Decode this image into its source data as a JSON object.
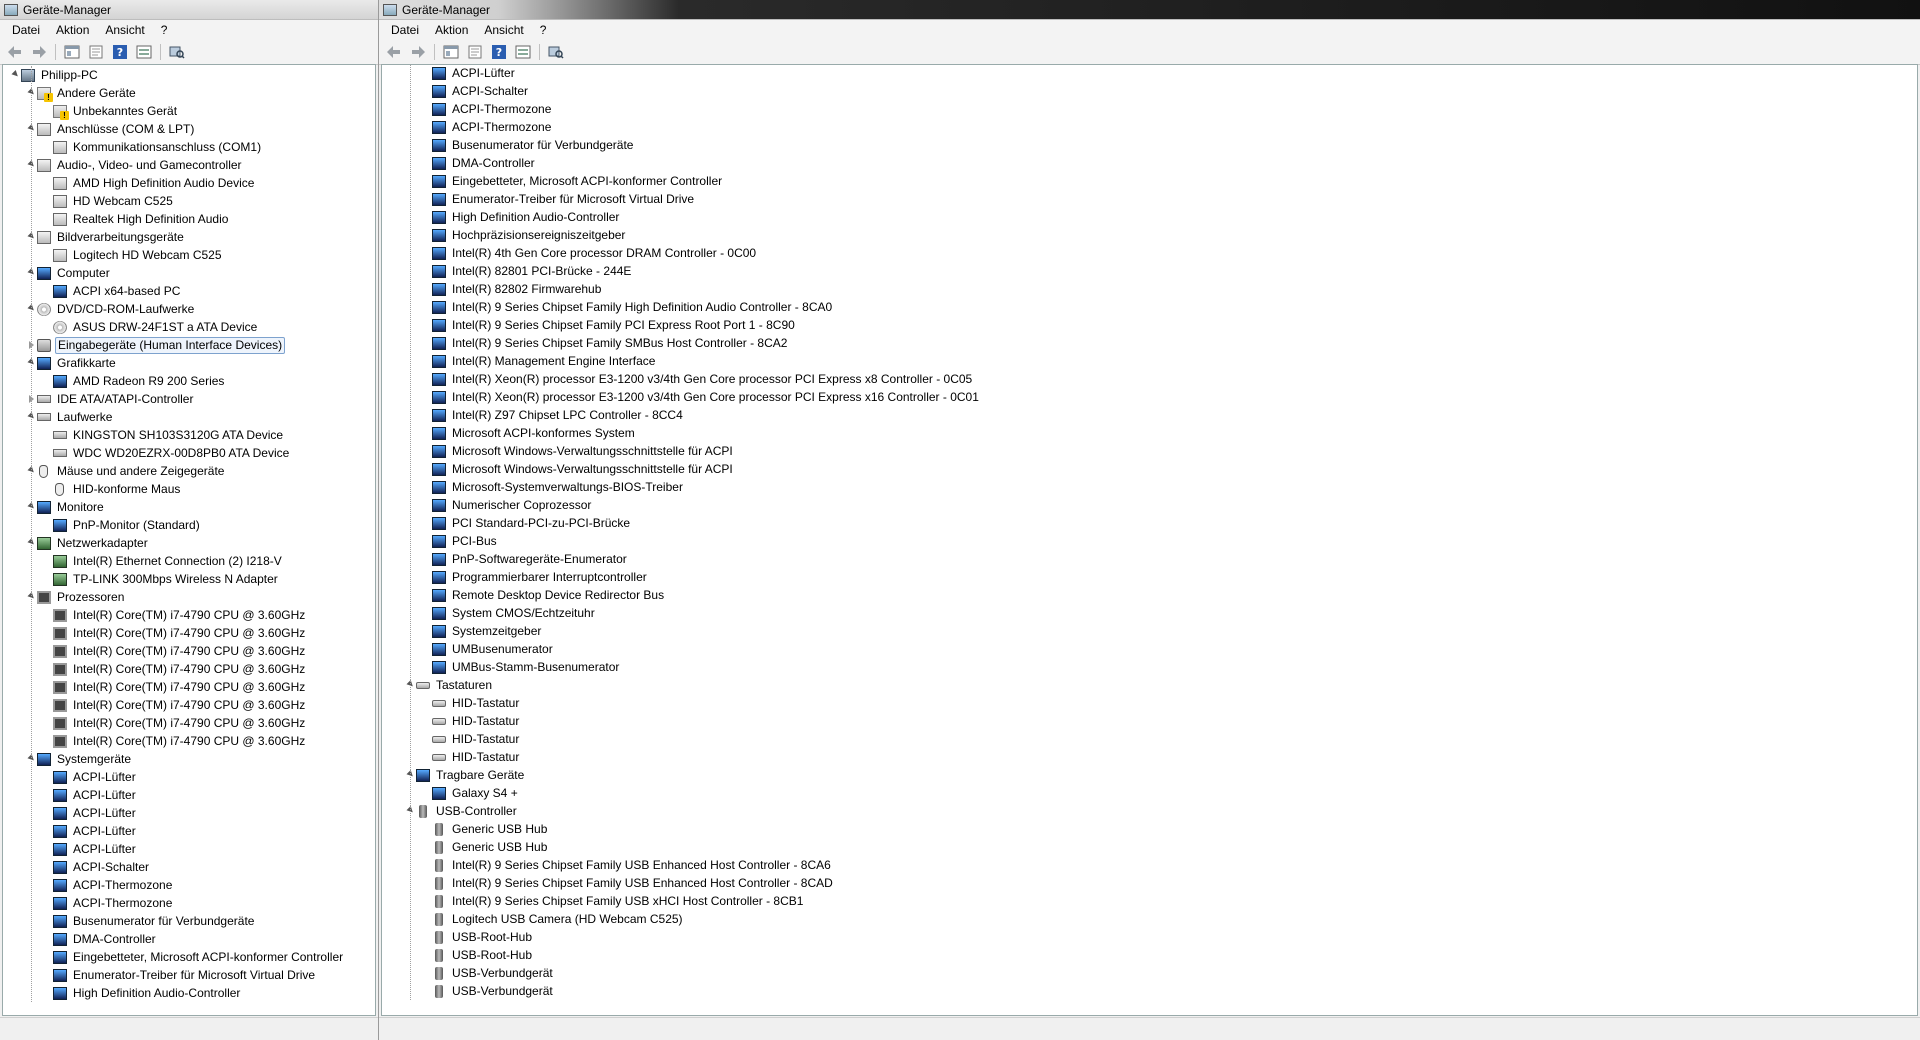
{
  "left": {
    "title": "Geräte-Manager",
    "menu": [
      "Datei",
      "Aktion",
      "Ansicht",
      "?"
    ],
    "tree": [
      {
        "label": "Philipp-PC",
        "depth": 0,
        "toggle": "expanded",
        "icon": "computer-icon"
      },
      {
        "label": "Andere Geräte",
        "depth": 1,
        "toggle": "expanded",
        "icon": "other-devices-icon"
      },
      {
        "label": "Unbekanntes Gerät",
        "depth": 2,
        "icon": "unknown-device-warning-icon"
      },
      {
        "label": "Anschlüsse (COM & LPT)",
        "depth": 1,
        "toggle": "expanded",
        "icon": "port-icon"
      },
      {
        "label": "Kommunikationsanschluss (COM1)",
        "depth": 2,
        "icon": "port-icon"
      },
      {
        "label": "Audio-, Video- und Gamecontroller",
        "depth": 1,
        "toggle": "expanded",
        "icon": "speaker-icon"
      },
      {
        "label": "AMD High Definition Audio Device",
        "depth": 2,
        "icon": "speaker-icon"
      },
      {
        "label": "HD Webcam C525",
        "depth": 2,
        "icon": "speaker-icon"
      },
      {
        "label": "Realtek High Definition Audio",
        "depth": 2,
        "icon": "speaker-icon"
      },
      {
        "label": "Bildverarbeitungsgeräte",
        "depth": 1,
        "toggle": "expanded",
        "icon": "camera-icon"
      },
      {
        "label": "Logitech HD Webcam C525",
        "depth": 2,
        "icon": "camera-icon"
      },
      {
        "label": "Computer",
        "depth": 1,
        "toggle": "expanded",
        "icon": "monitor-icon"
      },
      {
        "label": "ACPI x64-based PC",
        "depth": 2,
        "icon": "monitor-icon"
      },
      {
        "label": "DVD/CD-ROM-Laufwerke",
        "depth": 1,
        "toggle": "expanded",
        "icon": "cd-drive-icon"
      },
      {
        "label": "ASUS DRW-24F1ST   a ATA Device",
        "depth": 2,
        "icon": "cd-drive-icon"
      },
      {
        "label": "Eingabegeräte (Human Interface Devices)",
        "depth": 1,
        "toggle": "collapsed",
        "icon": "hid-icon",
        "selected": true
      },
      {
        "label": "Grafikkarte",
        "depth": 1,
        "toggle": "expanded",
        "icon": "display-adapter-icon"
      },
      {
        "label": "AMD Radeon R9 200 Series",
        "depth": 2,
        "icon": "display-adapter-icon"
      },
      {
        "label": "IDE ATA/ATAPI-Controller",
        "depth": 1,
        "toggle": "collapsed",
        "icon": "ide-controller-icon"
      },
      {
        "label": "Laufwerke",
        "depth": 1,
        "toggle": "expanded",
        "icon": "disk-drive-icon"
      },
      {
        "label": "KINGSTON SH103S3120G ATA Device",
        "depth": 2,
        "icon": "disk-drive-icon"
      },
      {
        "label": "WDC WD20EZRX-00D8PB0 ATA Device",
        "depth": 2,
        "icon": "disk-drive-icon"
      },
      {
        "label": "Mäuse und andere Zeigegeräte",
        "depth": 1,
        "toggle": "expanded",
        "icon": "mouse-icon"
      },
      {
        "label": "HID-konforme Maus",
        "depth": 2,
        "icon": "mouse-icon"
      },
      {
        "label": "Monitore",
        "depth": 1,
        "toggle": "expanded",
        "icon": "monitor-icon"
      },
      {
        "label": "PnP-Monitor (Standard)",
        "depth": 2,
        "icon": "monitor-icon"
      },
      {
        "label": "Netzwerkadapter",
        "depth": 1,
        "toggle": "expanded",
        "icon": "network-adapter-icon"
      },
      {
        "label": "Intel(R) Ethernet Connection (2) I218-V",
        "depth": 2,
        "icon": "network-adapter-icon"
      },
      {
        "label": "TP-LINK 300Mbps Wireless N Adapter",
        "depth": 2,
        "icon": "network-adapter-icon"
      },
      {
        "label": "Prozessoren",
        "depth": 1,
        "toggle": "expanded",
        "icon": "processor-icon"
      },
      {
        "label": "Intel(R) Core(TM) i7-4790 CPU @ 3.60GHz",
        "depth": 2,
        "icon": "processor-icon"
      },
      {
        "label": "Intel(R) Core(TM) i7-4790 CPU @ 3.60GHz",
        "depth": 2,
        "icon": "processor-icon"
      },
      {
        "label": "Intel(R) Core(TM) i7-4790 CPU @ 3.60GHz",
        "depth": 2,
        "icon": "processor-icon"
      },
      {
        "label": "Intel(R) Core(TM) i7-4790 CPU @ 3.60GHz",
        "depth": 2,
        "icon": "processor-icon"
      },
      {
        "label": "Intel(R) Core(TM) i7-4790 CPU @ 3.60GHz",
        "depth": 2,
        "icon": "processor-icon"
      },
      {
        "label": "Intel(R) Core(TM) i7-4790 CPU @ 3.60GHz",
        "depth": 2,
        "icon": "processor-icon"
      },
      {
        "label": "Intel(R) Core(TM) i7-4790 CPU @ 3.60GHz",
        "depth": 2,
        "icon": "processor-icon"
      },
      {
        "label": "Intel(R) Core(TM) i7-4790 CPU @ 3.60GHz",
        "depth": 2,
        "icon": "processor-icon"
      },
      {
        "label": "Systemgeräte",
        "depth": 1,
        "toggle": "expanded",
        "icon": "system-device-icon"
      },
      {
        "label": "ACPI-Lüfter",
        "depth": 2,
        "icon": "system-device-icon"
      },
      {
        "label": "ACPI-Lüfter",
        "depth": 2,
        "icon": "system-device-icon"
      },
      {
        "label": "ACPI-Lüfter",
        "depth": 2,
        "icon": "system-device-icon"
      },
      {
        "label": "ACPI-Lüfter",
        "depth": 2,
        "icon": "system-device-icon"
      },
      {
        "label": "ACPI-Lüfter",
        "depth": 2,
        "icon": "system-device-icon"
      },
      {
        "label": "ACPI-Schalter",
        "depth": 2,
        "icon": "system-device-icon"
      },
      {
        "label": "ACPI-Thermozone",
        "depth": 2,
        "icon": "system-device-icon"
      },
      {
        "label": "ACPI-Thermozone",
        "depth": 2,
        "icon": "system-device-icon"
      },
      {
        "label": "Busenumerator für Verbundgeräte",
        "depth": 2,
        "icon": "system-device-icon"
      },
      {
        "label": "DMA-Controller",
        "depth": 2,
        "icon": "system-device-icon"
      },
      {
        "label": "Eingebetteter, Microsoft ACPI-konformer Controller",
        "depth": 2,
        "icon": "system-device-icon"
      },
      {
        "label": "Enumerator-Treiber für Microsoft Virtual Drive",
        "depth": 2,
        "icon": "system-device-icon"
      },
      {
        "label": "High Definition Audio-Controller",
        "depth": 2,
        "icon": "system-device-icon"
      }
    ]
  },
  "right": {
    "title": "Geräte-Manager",
    "menu": [
      "Datei",
      "Aktion",
      "Ansicht",
      "?"
    ],
    "tree": [
      {
        "label": "ACPI-Lüfter",
        "depth": 2,
        "icon": "system-device-icon"
      },
      {
        "label": "ACPI-Schalter",
        "depth": 2,
        "icon": "system-device-icon"
      },
      {
        "label": "ACPI-Thermozone",
        "depth": 2,
        "icon": "system-device-icon"
      },
      {
        "label": "ACPI-Thermozone",
        "depth": 2,
        "icon": "system-device-icon"
      },
      {
        "label": "Busenumerator für Verbundgeräte",
        "depth": 2,
        "icon": "system-device-icon"
      },
      {
        "label": "DMA-Controller",
        "depth": 2,
        "icon": "system-device-icon"
      },
      {
        "label": "Eingebetteter, Microsoft ACPI-konformer Controller",
        "depth": 2,
        "icon": "system-device-icon"
      },
      {
        "label": "Enumerator-Treiber für Microsoft Virtual Drive",
        "depth": 2,
        "icon": "system-device-icon"
      },
      {
        "label": "High Definition Audio-Controller",
        "depth": 2,
        "icon": "system-device-icon"
      },
      {
        "label": "Hochpräzisionsereigniszeitgeber",
        "depth": 2,
        "icon": "system-device-icon"
      },
      {
        "label": "Intel(R) 4th Gen Core processor DRAM Controller - 0C00",
        "depth": 2,
        "icon": "system-device-icon"
      },
      {
        "label": "Intel(R) 82801 PCI-Brücke - 244E",
        "depth": 2,
        "icon": "system-device-icon"
      },
      {
        "label": "Intel(R) 82802 Firmwarehub",
        "depth": 2,
        "icon": "system-device-icon"
      },
      {
        "label": "Intel(R) 9 Series Chipset Family High Definition Audio Controller  - 8CA0",
        "depth": 2,
        "icon": "system-device-icon"
      },
      {
        "label": "Intel(R) 9 Series Chipset Family PCI Express Root Port 1 - 8C90",
        "depth": 2,
        "icon": "system-device-icon"
      },
      {
        "label": "Intel(R) 9 Series Chipset Family SMBus Host Controller  - 8CA2",
        "depth": 2,
        "icon": "system-device-icon"
      },
      {
        "label": "Intel(R) Management Engine Interface",
        "depth": 2,
        "icon": "system-device-icon"
      },
      {
        "label": "Intel(R) Xeon(R) processor E3-1200 v3/4th Gen Core processor PCI Express x8 Controller - 0C05",
        "depth": 2,
        "icon": "system-device-icon"
      },
      {
        "label": "Intel(R) Xeon(R) processor E3-1200 v3/4th Gen Core processor PCI Express x16 Controller - 0C01",
        "depth": 2,
        "icon": "system-device-icon"
      },
      {
        "label": "Intel(R) Z97 Chipset LPC Controller  - 8CC4",
        "depth": 2,
        "icon": "system-device-icon"
      },
      {
        "label": "Microsoft ACPI-konformes System",
        "depth": 2,
        "icon": "system-device-icon"
      },
      {
        "label": "Microsoft Windows-Verwaltungsschnittstelle für ACPI",
        "depth": 2,
        "icon": "system-device-icon"
      },
      {
        "label": "Microsoft Windows-Verwaltungsschnittstelle für ACPI",
        "depth": 2,
        "icon": "system-device-icon"
      },
      {
        "label": "Microsoft-Systemverwaltungs-BIOS-Treiber",
        "depth": 2,
        "icon": "system-device-icon"
      },
      {
        "label": "Numerischer Coprozessor",
        "depth": 2,
        "icon": "system-device-icon"
      },
      {
        "label": "PCI Standard-PCI-zu-PCI-Brücke",
        "depth": 2,
        "icon": "system-device-icon"
      },
      {
        "label": "PCI-Bus",
        "depth": 2,
        "icon": "system-device-icon"
      },
      {
        "label": "PnP-Softwaregeräte-Enumerator",
        "depth": 2,
        "icon": "system-device-icon"
      },
      {
        "label": "Programmierbarer Interruptcontroller",
        "depth": 2,
        "icon": "system-device-icon"
      },
      {
        "label": "Remote Desktop Device Redirector Bus",
        "depth": 2,
        "icon": "system-device-icon"
      },
      {
        "label": "System CMOS/Echtzeituhr",
        "depth": 2,
        "icon": "system-device-icon"
      },
      {
        "label": "Systemzeitgeber",
        "depth": 2,
        "icon": "system-device-icon"
      },
      {
        "label": "UMBusenumerator",
        "depth": 2,
        "icon": "system-device-icon"
      },
      {
        "label": "UMBus-Stamm-Busenumerator",
        "depth": 2,
        "icon": "system-device-icon"
      },
      {
        "label": "Tastaturen",
        "depth": 1,
        "toggle": "expanded",
        "icon": "keyboard-icon"
      },
      {
        "label": "HID-Tastatur",
        "depth": 2,
        "icon": "keyboard-icon"
      },
      {
        "label": "HID-Tastatur",
        "depth": 2,
        "icon": "keyboard-icon"
      },
      {
        "label": "HID-Tastatur",
        "depth": 2,
        "icon": "keyboard-icon"
      },
      {
        "label": "HID-Tastatur",
        "depth": 2,
        "icon": "keyboard-icon"
      },
      {
        "label": "Tragbare Geräte",
        "depth": 1,
        "toggle": "expanded",
        "icon": "portable-device-icon"
      },
      {
        "label": "Galaxy S4 +",
        "depth": 2,
        "icon": "portable-device-icon"
      },
      {
        "label": "USB-Controller",
        "depth": 1,
        "toggle": "expanded",
        "icon": "usb-icon"
      },
      {
        "label": "Generic USB Hub",
        "depth": 2,
        "icon": "usb-icon"
      },
      {
        "label": "Generic USB Hub",
        "depth": 2,
        "icon": "usb-icon"
      },
      {
        "label": "Intel(R) 9 Series Chipset Family USB Enhanced Host Controller  - 8CA6",
        "depth": 2,
        "icon": "usb-icon"
      },
      {
        "label": "Intel(R) 9 Series Chipset Family USB Enhanced Host Controller  - 8CAD",
        "depth": 2,
        "icon": "usb-icon"
      },
      {
        "label": "Intel(R) 9 Series Chipset Family USB xHCI Host Controller  - 8CB1",
        "depth": 2,
        "icon": "usb-icon"
      },
      {
        "label": "Logitech USB Camera (HD Webcam C525)",
        "depth": 2,
        "icon": "usb-icon"
      },
      {
        "label": "USB-Root-Hub",
        "depth": 2,
        "icon": "usb-icon"
      },
      {
        "label": "USB-Root-Hub",
        "depth": 2,
        "icon": "usb-icon"
      },
      {
        "label": "USB-Verbundgerät",
        "depth": 2,
        "icon": "usb-icon"
      },
      {
        "label": "USB-Verbundgerät",
        "depth": 2,
        "icon": "usb-icon"
      }
    ]
  }
}
